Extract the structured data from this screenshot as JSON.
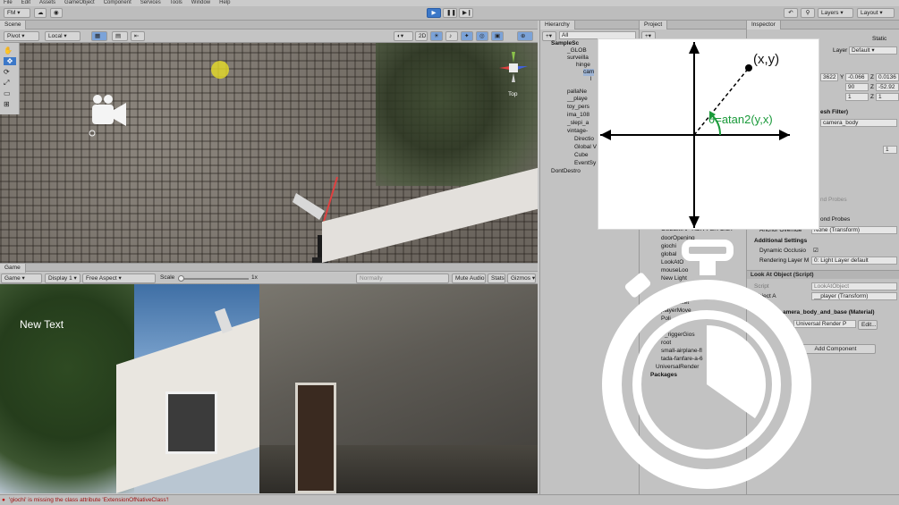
{
  "menubar": {
    "items": [
      "File",
      "Edit",
      "Assets",
      "GameObject",
      "Component",
      "Services",
      "Tools",
      "Window",
      "Help"
    ]
  },
  "toolbar": {
    "account": "FM",
    "right": {
      "layers": "Layers",
      "layout": "Layout"
    }
  },
  "scene": {
    "tab": "Scene",
    "pivot": "Pivot",
    "space": "Local",
    "mode_2d": "2D",
    "gizmo_label": "Top"
  },
  "game": {
    "tab": "Game",
    "display_mode": "Game",
    "display": "Display 1",
    "aspect": "Free Aspect",
    "scale_label": "Scale",
    "scale_value": "1x",
    "quality": "Normally",
    "mute": "Mute Audio",
    "stats": "Stats",
    "gizmos": "Gizmos",
    "overlay_text": "New Text"
  },
  "hierarchy": {
    "tab": "Hierarchy",
    "search": "All",
    "items": [
      "SampleSc",
      "_GLOB",
      "surveilla",
      "hinge",
      "cam",
      "l",
      "pallaNe",
      "__playe",
      "toy_pers",
      "ima_108",
      "_slepi_a",
      "vintage-",
      "Directio",
      "Global V",
      "Cube",
      "EventSy",
      "DontDestro"
    ]
  },
  "project": {
    "tab": "Project",
    "items": [
      "CUBEMAP-HDR-PER-DIET",
      "doorOpening",
      "giochi",
      "global",
      "LookAtO",
      "mouseLoo",
      "New Light",
      "basket",
      "playerMove",
      "Poli",
      "_riggerGios",
      "root",
      "small-airplane-fl",
      "tada-fanfare-a-6",
      "UniversalRender"
    ],
    "packages": "Packages"
  },
  "inspector": {
    "tab": "Inspector",
    "static": "Static",
    "layer_label": "Layer",
    "layer_value": "Default",
    "position": {
      "x": "3622",
      "y": "-0.066",
      "z": "0.0136"
    },
    "rotation": {
      "y": "90",
      "z": "-52.92"
    },
    "scale": {
      "y": "1",
      "z": "1"
    },
    "mesh_filter": "esh Filter)",
    "mesh_value": "camera_body",
    "probe_value": "nd Probes",
    "probes": "ond Probes",
    "anchor_label": "Anchor Override",
    "anchor_value": "None (Transform)",
    "additional": "Additional Settings",
    "dynamic": "Dynamic Occlusio",
    "rendering_layer": "Rendering Layer M",
    "rendering_value": "0: Light Layer default",
    "lookat_title": "Look At Object (Script)",
    "script_label": "Script",
    "script_value": "LookAtObject",
    "object_label": "Object A",
    "object_value": "__player (Transform)",
    "material": "amera_body_and_base (Material)",
    "shader": "Universal Render P",
    "edit": "Edit...",
    "add_component": "Add Component",
    "one_value": "1"
  },
  "diagram": {
    "point_label": "(x,y)",
    "angle_label": "θ=atan2(y,x)"
  },
  "status": {
    "message": "'giochi' is missing the class attribute 'ExtensionOfNativeClass'!"
  },
  "colors": {
    "accent": "#3c78c8",
    "angle": "#1a9a3a",
    "status_error": "#a01010"
  }
}
